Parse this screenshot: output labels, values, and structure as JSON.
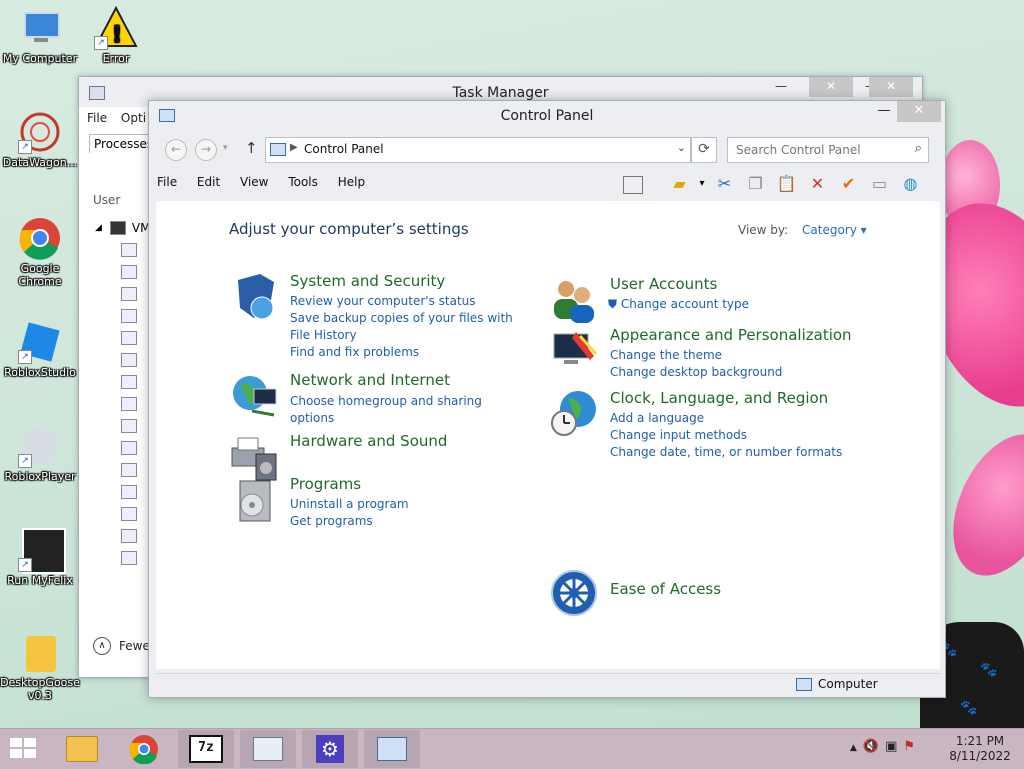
{
  "desktop": {
    "icons": [
      {
        "label": "My Computer"
      },
      {
        "label": "Error"
      },
      {
        "label": "DataWagon..."
      },
      {
        "label": "Google Chrome"
      },
      {
        "label": "RobloxStudio"
      },
      {
        "label": "RobloxPlayer"
      },
      {
        "label": "Run MyFelix"
      },
      {
        "label": "DesktopGoose v0.3"
      }
    ]
  },
  "task_manager": {
    "title": "Task Manager",
    "menu": [
      "File",
      "Opti"
    ],
    "tab": "Processes",
    "column_user": "User",
    "first_row": "VM",
    "fewer_details": "Fewe"
  },
  "control_panel": {
    "title": "Control Panel",
    "address": "Control Panel",
    "search_placeholder": "Search Control Panel",
    "menu": [
      "File",
      "Edit",
      "View",
      "Tools",
      "Help"
    ],
    "heading": "Adjust your computer’s settings",
    "view_by_label": "View by:",
    "view_by_value": "Category",
    "categories_left": [
      {
        "title": "System and Security",
        "links": [
          "Review your computer's status",
          "Save backup copies of your files with File History",
          "Find and fix problems"
        ]
      },
      {
        "title": "Network and Internet",
        "links": [
          "Choose homegroup and sharing options"
        ]
      },
      {
        "title": "Hardware and Sound",
        "links": []
      },
      {
        "title": "Programs",
        "links": [
          "Uninstall a program",
          "Get programs"
        ]
      }
    ],
    "categories_right": [
      {
        "title": "User Accounts",
        "links": [
          "Change account type"
        ]
      },
      {
        "title": "Appearance and Personalization",
        "links": [
          "Change the theme",
          "Change desktop background"
        ]
      },
      {
        "title": "Clock, Language, and Region",
        "links": [
          "Add a language",
          "Change input methods",
          "Change date, time, or number formats"
        ]
      },
      {
        "title": "Ease of Access",
        "links": []
      }
    ],
    "status": "Computer"
  },
  "taskbar": {
    "time": "1:21 PM",
    "date": "8/11/2022"
  }
}
